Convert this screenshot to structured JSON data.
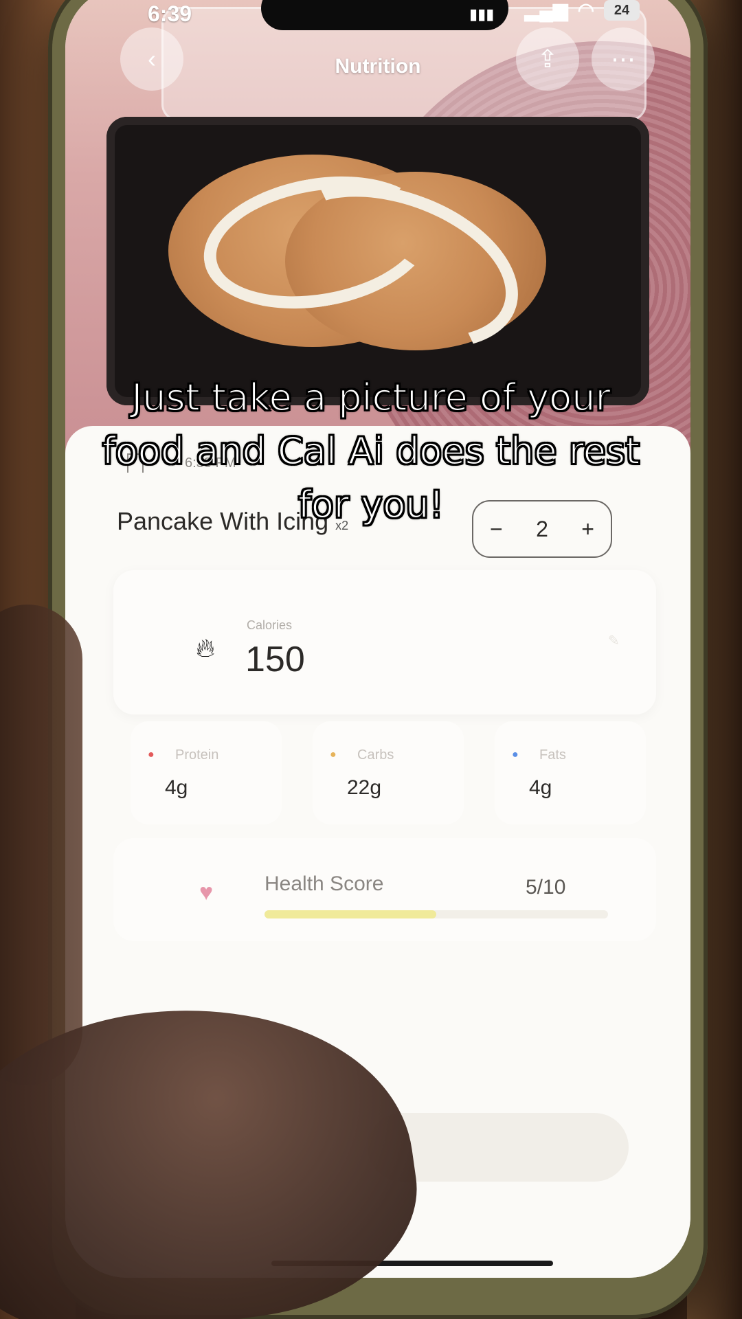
{
  "status_bar": {
    "time": "6:39",
    "battery": "24"
  },
  "header": {
    "title": "Nutrition"
  },
  "entry": {
    "time": "6:38 PM",
    "name": "Pancake With Icing",
    "quantity_suffix": "x2",
    "stepper": {
      "minus": "−",
      "value": "2",
      "plus": "+"
    }
  },
  "calories": {
    "label": "Calories",
    "value": "150"
  },
  "macros": [
    {
      "label": "Protein",
      "value": "4g",
      "color": "#e35a5a"
    },
    {
      "label": "Carbs",
      "value": "22g",
      "color": "#e6b35a"
    },
    {
      "label": "Fats",
      "value": "4g",
      "color": "#5a8fe6"
    }
  ],
  "health_score": {
    "label": "Health Score",
    "value": "5/10",
    "fraction": 0.5
  },
  "caption": {
    "line1": "Just take a picture of your",
    "line2": "food and Cal Ai does the rest",
    "line3": "for you!"
  },
  "icons": {
    "back": "back-icon",
    "share": "share-icon",
    "more": "more-icon",
    "bookmark": "bookmark-icon",
    "flame": "flame-icon",
    "heart": "heart-icon"
  }
}
